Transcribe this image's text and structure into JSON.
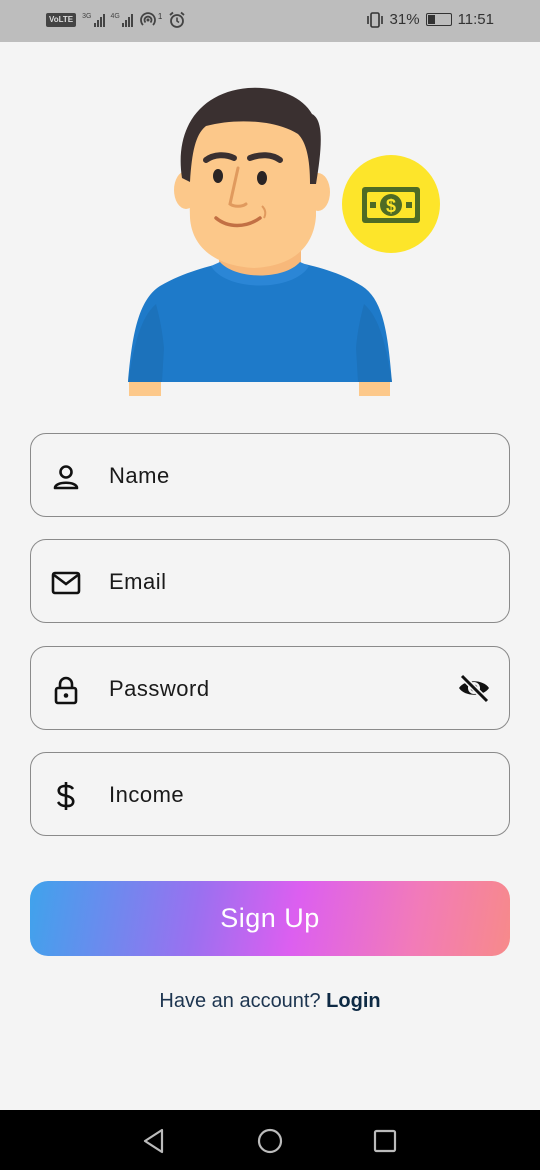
{
  "status_bar": {
    "volte": "VoLTE",
    "net1": "3G",
    "net2": "4G",
    "hotspot_count": "1",
    "battery_percent": "31%",
    "battery_level": 0.31,
    "time": "11:51"
  },
  "illustration": {
    "avatar_icon": "man-blue-shirt",
    "badge_icon": "dollar-bill-icon",
    "badge_color": "#fde52a",
    "shirt_color": "#1e7ac9"
  },
  "form": {
    "name_placeholder": "Name",
    "email_placeholder": "Email",
    "password_placeholder": "Password",
    "income_placeholder": "Income"
  },
  "signup_label": "Sign Up",
  "footer": {
    "prompt": "Have an account? ",
    "login_label": "Login"
  }
}
